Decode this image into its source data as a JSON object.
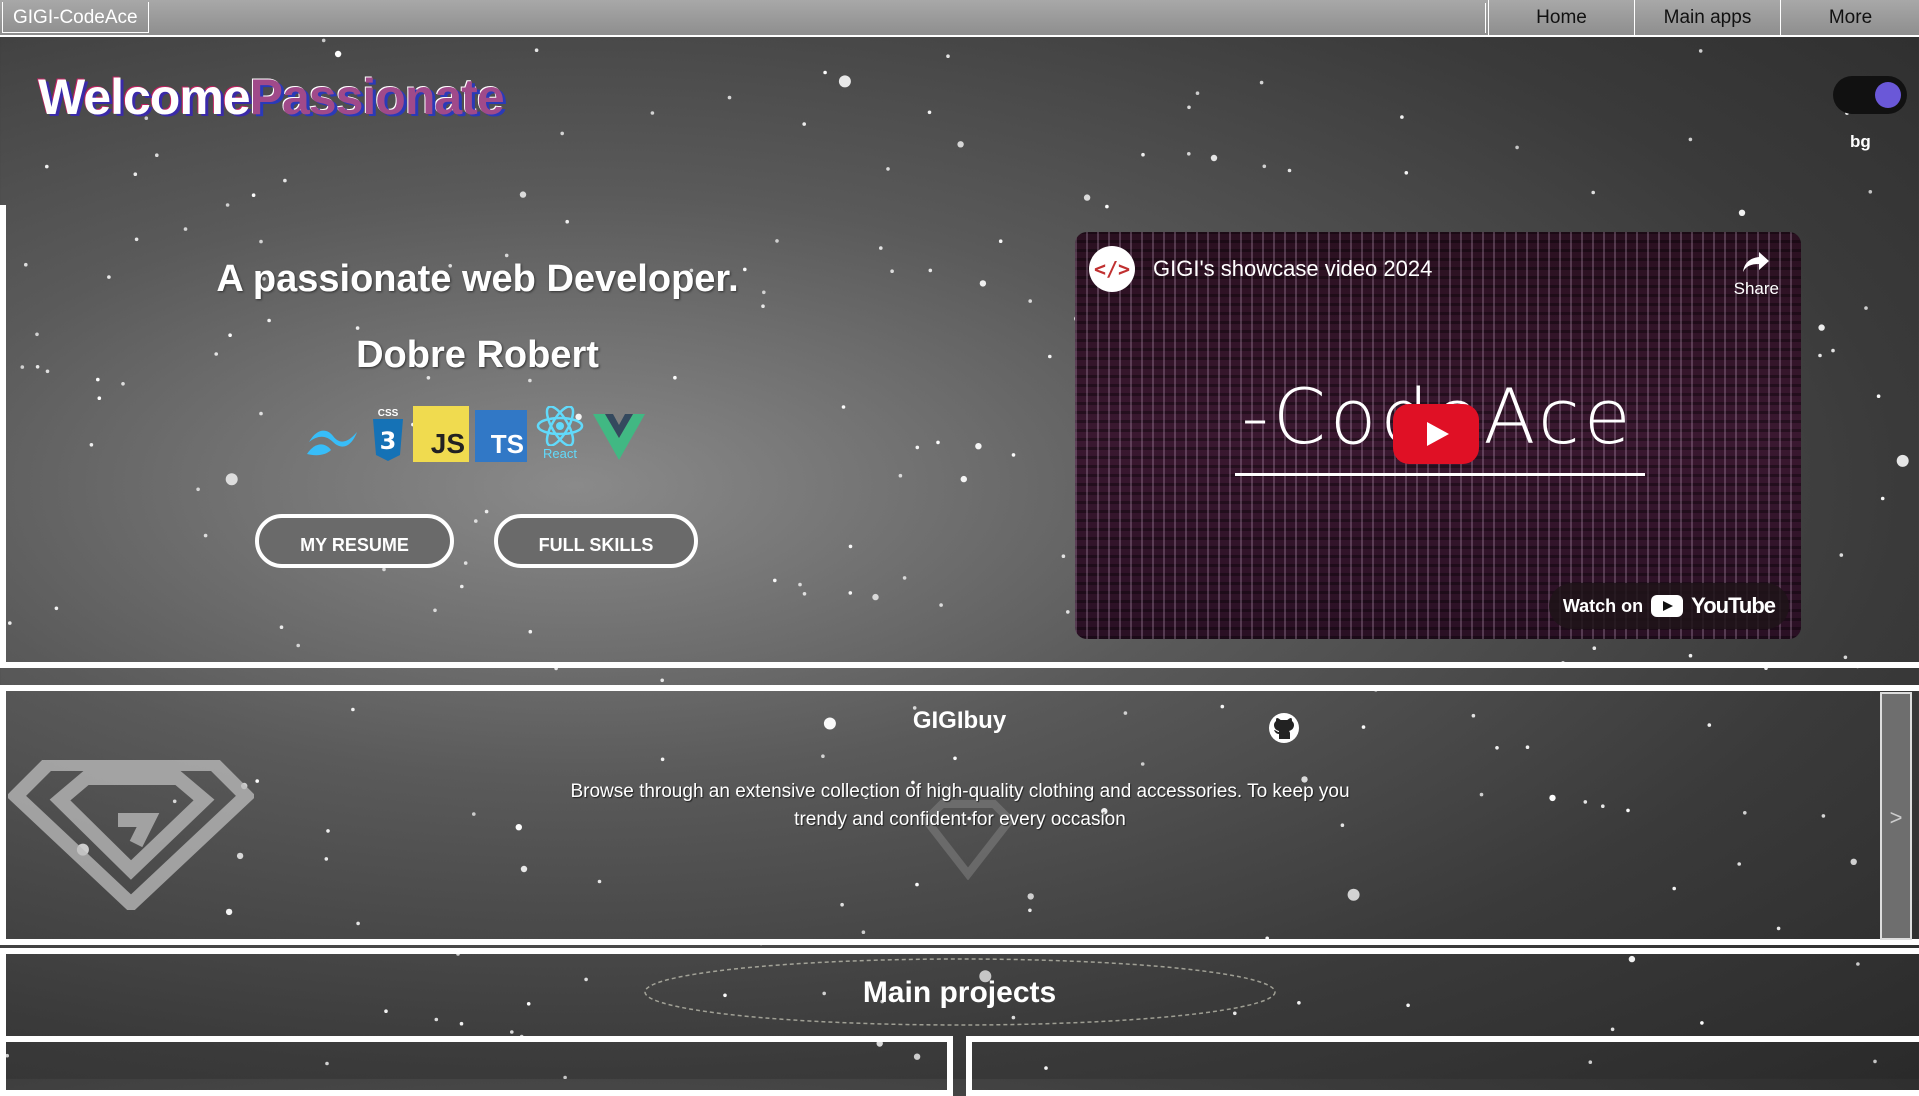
{
  "nav": {
    "brand": "GIGI-CodeAce",
    "links": [
      "Home",
      "Main apps",
      "More"
    ]
  },
  "hero": {
    "welcome_a": "Welcome",
    "welcome_b": "Passionate",
    "toggle_label": "bg",
    "tagline": "A passionate web Developer.",
    "name": "Dobre Robert",
    "tech": [
      "Tailwind",
      "CSS",
      "JS",
      "TS",
      "React",
      "Vue"
    ],
    "buttons": {
      "resume": "MY RESUME",
      "skills": "FULL SKILLS"
    }
  },
  "video": {
    "title": "GIGI's showcase video 2024",
    "share": "Share",
    "watch_on": "Watch on",
    "youtube": "YouTube",
    "logo_text": "-CodeAce",
    "channel_icon": "</>"
  },
  "project_banner": {
    "title": "GIGIbuy",
    "description": "Browse through an extensive collection of high-quality clothing and accessories. To keep you trendy and confident for every occasion",
    "next_arrow": ">"
  },
  "main_projects": {
    "title": "Main projects"
  },
  "colors": {
    "accent_purple": "#6a58d8",
    "youtube_red": "#e01025"
  }
}
